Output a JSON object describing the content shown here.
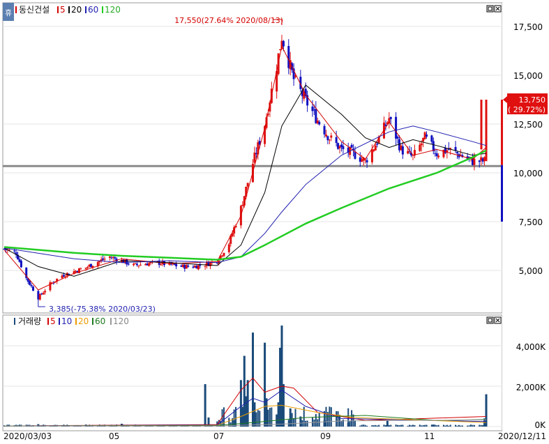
{
  "app": {
    "side_tab_label": "휴"
  },
  "price_panel": {
    "stock_name": "동신건설",
    "ma_legend": [
      {
        "label": "5",
        "color": "#d40000"
      },
      {
        "label": "20",
        "color": "#000000"
      },
      {
        "label": "60",
        "color": "#1f1fb0"
      },
      {
        "label": "120",
        "color": "#22cc22"
      }
    ],
    "high_annotation": "17,550(27.64% 2020/08/13)",
    "low_annotation": "3,385(-75.38% 2020/03/23)",
    "current_price": "13,750",
    "current_change": "( 29.72%)",
    "y_tick_labels": [
      "17,500",
      "15,000",
      "12,500",
      "10,000",
      "7,500",
      "5,000"
    ]
  },
  "volume_panel": {
    "title": "거래량",
    "ma_legend": [
      {
        "label": "5",
        "color": "#d40000"
      },
      {
        "label": "10",
        "color": "#1f1fb0"
      },
      {
        "label": "20",
        "color": "#e89b00"
      },
      {
        "label": "60",
        "color": "#1e7a1e"
      },
      {
        "label": "120",
        "color": "#999999"
      }
    ],
    "y_tick_labels": [
      "4,000K",
      "2,000K",
      "0K"
    ]
  },
  "x_axis": {
    "labels": [
      "2020/03/03",
      "05",
      "07",
      "09",
      "11",
      "2020/12/11"
    ]
  },
  "colors": {
    "up": "#e01010",
    "down": "#1010c0",
    "volume": "#1a4a7a",
    "ref_line": "#8a8a8a"
  },
  "chart_data": [
    {
      "type": "candlestick",
      "title": "동신건설",
      "x_range": [
        "2020/03/03",
        "2020/12/11"
      ],
      "ylim": [
        3000,
        18500
      ],
      "yticks": [
        5000,
        7500,
        10000,
        12500,
        15000,
        17500
      ],
      "reference_line": 10350,
      "annotations": [
        {
          "text": "17,550(27.64% 2020/08/13)",
          "date": "2020/08/13",
          "value": 17550
        },
        {
          "text": "3,385(-75.38% 2020/03/23)",
          "date": "2020/03/23",
          "value": 3385
        }
      ],
      "last_close": 13750,
      "last_change_pct": 29.72,
      "approx_close_path": [
        [
          "2020/03/03",
          6100
        ],
        [
          "2020/03/10",
          5900
        ],
        [
          "2020/03/16",
          4600
        ],
        [
          "2020/03/23",
          3600
        ],
        [
          "2020/03/30",
          4300
        ],
        [
          "2020/04/06",
          4750
        ],
        [
          "2020/04/13",
          4950
        ],
        [
          "2020/04/20",
          5150
        ],
        [
          "2020/04/27",
          5450
        ],
        [
          "2020/05/04",
          5700
        ],
        [
          "2020/05/11",
          5500
        ],
        [
          "2020/05/18",
          5250
        ],
        [
          "2020/05/25",
          5350
        ],
        [
          "2020/06/01",
          5400
        ],
        [
          "2020/06/08",
          5300
        ],
        [
          "2020/06/15",
          5200
        ],
        [
          "2020/06/22",
          5200
        ],
        [
          "2020/06/29",
          5300
        ],
        [
          "2020/07/06",
          5500
        ],
        [
          "2020/07/13",
          6400
        ],
        [
          "2020/07/20",
          8200
        ],
        [
          "2020/07/27",
          10500
        ],
        [
          "2020/08/03",
          12500
        ],
        [
          "2020/08/10",
          15500
        ],
        [
          "2020/08/13",
          17000
        ],
        [
          "2020/08/20",
          14800
        ],
        [
          "2020/08/27",
          13700
        ],
        [
          "2020/09/03",
          12700
        ],
        [
          "2020/09/10",
          11800
        ],
        [
          "2020/09/17",
          11200
        ],
        [
          "2020/09/24",
          11000
        ],
        [
          "2020/10/01",
          10600
        ],
        [
          "2020/10/08",
          11600
        ],
        [
          "2020/10/15",
          12800
        ],
        [
          "2020/10/22",
          11200
        ],
        [
          "2020/10/29",
          10800
        ],
        [
          "2020/11/05",
          11800
        ],
        [
          "2020/11/12",
          11000
        ],
        [
          "2020/11/19",
          11200
        ],
        [
          "2020/11/26",
          10900
        ],
        [
          "2020/12/03",
          10600
        ],
        [
          "2020/12/10",
          10600
        ],
        [
          "2020/12/11",
          13750
        ]
      ],
      "series": [
        {
          "name": "5",
          "values": [
            [
              "2020/03/03",
              6050
            ],
            [
              "2020/03/23",
              4000
            ],
            [
              "2020/04/13",
              4850
            ],
            [
              "2020/05/11",
              5600
            ],
            [
              "2020/06/08",
              5350
            ],
            [
              "2020/07/06",
              5450
            ],
            [
              "2020/07/20",
              7800
            ],
            [
              "2020/08/03",
              12300
            ],
            [
              "2020/08/13",
              16500
            ],
            [
              "2020/08/27",
              14000
            ],
            [
              "2020/09/17",
              11600
            ],
            [
              "2020/10/01",
              10700
            ],
            [
              "2020/10/15",
              12600
            ],
            [
              "2020/10/29",
              10900
            ],
            [
              "2020/11/12",
              11200
            ],
            [
              "2020/12/03",
              10700
            ],
            [
              "2020/12/11",
              11300
            ]
          ]
        },
        {
          "name": "20",
          "values": [
            [
              "2020/03/03",
              6150
            ],
            [
              "2020/03/23",
              5200
            ],
            [
              "2020/04/13",
              4700
            ],
            [
              "2020/05/11",
              5500
            ],
            [
              "2020/06/08",
              5400
            ],
            [
              "2020/07/06",
              5250
            ],
            [
              "2020/07/20",
              6300
            ],
            [
              "2020/08/03",
              9000
            ],
            [
              "2020/08/13",
              12400
            ],
            [
              "2020/08/27",
              14500
            ],
            [
              "2020/09/17",
              13000
            ],
            [
              "2020/10/01",
              11800
            ],
            [
              "2020/10/15",
              11300
            ],
            [
              "2020/10/29",
              11700
            ],
            [
              "2020/11/12",
              11400
            ],
            [
              "2020/12/03",
              10900
            ],
            [
              "2020/12/11",
              11000
            ]
          ]
        },
        {
          "name": "60",
          "values": [
            [
              "2020/03/03",
              6150
            ],
            [
              "2020/04/13",
              5600
            ],
            [
              "2020/05/11",
              5400
            ],
            [
              "2020/06/08",
              5500
            ],
            [
              "2020/07/06",
              5400
            ],
            [
              "2020/07/20",
              5700
            ],
            [
              "2020/08/03",
              6900
            ],
            [
              "2020/08/13",
              8000
            ],
            [
              "2020/08/27",
              9400
            ],
            [
              "2020/09/17",
              10900
            ],
            [
              "2020/10/15",
              12100
            ],
            [
              "2020/10/29",
              12400
            ],
            [
              "2020/11/12",
              12100
            ],
            [
              "2020/12/03",
              11600
            ],
            [
              "2020/12/11",
              11400
            ]
          ]
        },
        {
          "name": "120",
          "values": [
            [
              "2020/03/03",
              6200
            ],
            [
              "2020/04/13",
              5900
            ],
            [
              "2020/05/11",
              5750
            ],
            [
              "2020/06/08",
              5650
            ],
            [
              "2020/07/06",
              5550
            ],
            [
              "2020/07/20",
              5700
            ],
            [
              "2020/08/03",
              6300
            ],
            [
              "2020/08/27",
              7400
            ],
            [
              "2020/09/17",
              8200
            ],
            [
              "2020/10/15",
              9200
            ],
            [
              "2020/11/12",
              10000
            ],
            [
              "2020/12/03",
              10800
            ],
            [
              "2020/12/11",
              11150
            ]
          ]
        }
      ]
    },
    {
      "type": "bar",
      "title": "거래량",
      "unit": "K",
      "ylim": [
        0,
        5200
      ],
      "yticks": [
        0,
        2000,
        4000
      ],
      "values": [
        [
          "2020/03/05",
          90
        ],
        [
          "2020/03/23",
          120
        ],
        [
          "2020/04/20",
          100
        ],
        [
          "2020/05/11",
          140
        ],
        [
          "2020/06/29",
          2100
        ],
        [
          "2020/07/01",
          450
        ],
        [
          "2020/07/16",
          300
        ],
        [
          "2020/07/20",
          2300
        ],
        [
          "2020/07/21",
          900
        ],
        [
          "2020/07/22",
          3500
        ],
        [
          "2020/07/23",
          1500
        ],
        [
          "2020/07/24",
          2300
        ],
        [
          "2020/07/27",
          4650
        ],
        [
          "2020/07/28",
          1200
        ],
        [
          "2020/08/03",
          4150
        ],
        [
          "2020/08/04",
          1400
        ],
        [
          "2020/08/10",
          600
        ],
        [
          "2020/08/11",
          1200
        ],
        [
          "2020/08/12",
          3900
        ],
        [
          "2020/08/13",
          5000
        ],
        [
          "2020/08/14",
          2100
        ],
        [
          "2020/08/18",
          900
        ],
        [
          "2020/08/24",
          500
        ],
        [
          "2020/09/07",
          300
        ],
        [
          "2020/09/21",
          200
        ],
        [
          "2020/10/14",
          300
        ],
        [
          "2020/11/10",
          100
        ],
        [
          "2020/12/10",
          400
        ],
        [
          "2020/12/11",
          1600
        ]
      ],
      "series": [
        {
          "name": "5",
          "values": [
            [
              "2020/07/06",
              100
            ],
            [
              "2020/07/20",
              1800
            ],
            [
              "2020/07/27",
              2400
            ],
            [
              "2020/08/03",
              1700
            ],
            [
              "2020/08/13",
              2000
            ],
            [
              "2020/08/20",
              1900
            ],
            [
              "2020/09/03",
              700
            ],
            [
              "2020/10/01",
              300
            ],
            [
              "2020/12/11",
              500
            ]
          ]
        },
        {
          "name": "10",
          "values": [
            [
              "2020/07/06",
              80
            ],
            [
              "2020/07/20",
              1000
            ],
            [
              "2020/07/27",
              1400
            ],
            [
              "2020/08/03",
              1200
            ],
            [
              "2020/08/13",
              1800
            ],
            [
              "2020/08/27",
              1000
            ],
            [
              "2020/09/17",
              400
            ],
            [
              "2020/12/11",
              250
            ]
          ]
        },
        {
          "name": "20",
          "values": [
            [
              "2020/07/06",
              60
            ],
            [
              "2020/07/20",
              500
            ],
            [
              "2020/08/03",
              1000
            ],
            [
              "2020/08/13",
              1050
            ],
            [
              "2020/09/03",
              700
            ],
            [
              "2020/09/24",
              450
            ],
            [
              "2020/12/11",
              200
            ]
          ]
        },
        {
          "name": "60",
          "values": [
            [
              "2020/07/06",
              50
            ],
            [
              "2020/07/27",
              200
            ],
            [
              "2020/08/27",
              450
            ],
            [
              "2020/10/01",
              550
            ],
            [
              "2020/11/12",
              300
            ],
            [
              "2020/12/11",
              350
            ]
          ]
        },
        {
          "name": "120",
          "values": [
            [
              "2020/07/06",
              30
            ],
            [
              "2020/08/13",
              120
            ],
            [
              "2020/09/17",
              280
            ],
            [
              "2020/12/11",
              330
            ]
          ]
        }
      ]
    }
  ]
}
